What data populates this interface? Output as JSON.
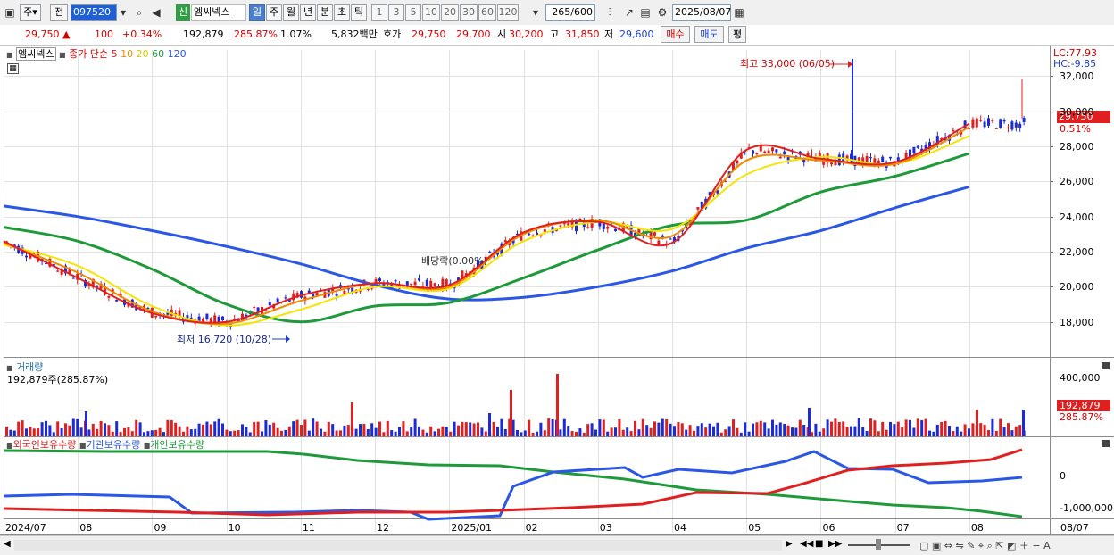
{
  "toolbar": {
    "market_label": "주",
    "prev_label": "전",
    "code": "097520",
    "credit_badge": "신",
    "stock_name": "엠씨넥스",
    "period_tabs": [
      "일",
      "주",
      "월",
      "년",
      "분",
      "초",
      "틱"
    ],
    "period_selected": "일",
    "interval_buttons": [
      "1",
      "3",
      "5",
      "10",
      "20",
      "30",
      "60",
      "120"
    ],
    "count_value": "265",
    "count_total": "/600",
    "date_value": "2025/08/07"
  },
  "quote": {
    "price": "29,750",
    "change": "100",
    "change_pct": "+0.34%",
    "volume": "192,879",
    "volume_ratio": "285.87%",
    "turnover_pct": "1.07%",
    "amount": "5,832백만",
    "hoga_label": "호가",
    "ask": "29,750",
    "bid": "29,700",
    "open_label": "시",
    "open": "30,200",
    "high_label": "고",
    "high": "31,850",
    "low_label": "저",
    "low": "29,600",
    "buy_button": "매수",
    "sell_button": "매도",
    "avg_button": "평"
  },
  "price_panel": {
    "name_tag": "엠씨넥스",
    "ma_title": "종가 단순",
    "ma_periods": [
      "5",
      "10",
      "20",
      "60",
      "120"
    ],
    "lc": "LC:77.93",
    "hc": "HC:-9.85",
    "current_price_tag": "29,750",
    "current_pct_tag": "0.51%",
    "high_annotation": "최고 33,000 (06/05)",
    "low_annotation": "최저 16,720 (10/28)",
    "dividend_annotation": "배당락(0.00%)",
    "y_ticks": [
      "32,000",
      "30,000",
      "28,000",
      "26,000",
      "24,000",
      "22,000",
      "20,000",
      "18,000"
    ]
  },
  "volume_panel": {
    "title": "거래량",
    "value": "192,879주(285.87%)",
    "y_tick": "400,000",
    "tag_value": "192,879",
    "tag_pct": "285.87%"
  },
  "holding_panel": {
    "legend": [
      "외국인보유수량",
      "기관보유수량",
      "개인보유수량"
    ],
    "y_ticks": [
      "0",
      "-1,000,000"
    ]
  },
  "x_axis": {
    "labels": [
      "2024/07",
      "08",
      "09",
      "10",
      "11",
      "12",
      "2025/01",
      "02",
      "03",
      "04",
      "05",
      "06",
      "07",
      "08"
    ],
    "right_label": "08/07"
  },
  "colors": {
    "ma5": "#e02020",
    "ma10": "#f08a00",
    "ma20": "#f4e400",
    "ma60": "#1f9a3a",
    "ma120": "#2b57e6",
    "up": "#e02020",
    "down": "#1c2bd6",
    "foreign": "#e02020",
    "institution": "#2b57e6",
    "individual": "#1f9a3a"
  },
  "chart_data": {
    "type": "line",
    "x": [
      "2024/07",
      "08",
      "09",
      "10",
      "11",
      "12",
      "2025/01",
      "02",
      "03",
      "04",
      "05",
      "06",
      "07",
      "08"
    ],
    "series": [
      {
        "name": "5",
        "values": [
          22600,
          20500,
          18500,
          18000,
          19500,
          20200,
          20100,
          23100,
          23700,
          22500,
          27800,
          27300,
          27100,
          29300
        ]
      },
      {
        "name": "10",
        "values": [
          22500,
          20800,
          18600,
          17900,
          19200,
          20200,
          20000,
          23000,
          23800,
          22900,
          27200,
          27200,
          27000,
          29100
        ]
      },
      {
        "name": "20",
        "values": [
          22400,
          21200,
          18900,
          17800,
          18700,
          20000,
          19900,
          22600,
          23700,
          23300,
          26400,
          27400,
          27000,
          28600
        ]
      },
      {
        "name": "60",
        "values": [
          23400,
          22600,
          21000,
          19000,
          18000,
          18900,
          19100,
          20500,
          22100,
          23500,
          23800,
          25400,
          26300,
          27600
        ]
      },
      {
        "name": "120",
        "values": [
          24600,
          24000,
          23200,
          22300,
          21300,
          20100,
          19300,
          19400,
          20000,
          20900,
          22200,
          23200,
          24500,
          25700
        ]
      }
    ],
    "annotations": [
      "최고 33,000 (06/05)",
      "최저 16,720 (10/28)",
      "배당락(0.00%)"
    ],
    "ylim": [
      16000,
      33500
    ]
  }
}
